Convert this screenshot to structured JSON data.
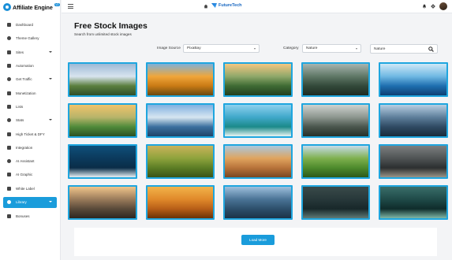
{
  "brand": {
    "name": "Affiliate Engine",
    "badge": "V2"
  },
  "sidebar": {
    "items": [
      {
        "label": "Dashboard",
        "icon": "home-icon",
        "caret": false,
        "active": false
      },
      {
        "label": "Theme Gallery",
        "icon": "palette-icon",
        "caret": false,
        "active": false
      },
      {
        "label": "Sites",
        "icon": "globe-icon",
        "caret": true,
        "active": false
      },
      {
        "label": "Automation",
        "icon": "robot-icon",
        "caret": false,
        "active": false
      },
      {
        "label": "Get Traffic",
        "icon": "chart-icon",
        "caret": true,
        "active": false
      },
      {
        "label": "Monetization",
        "icon": "dollar-icon",
        "caret": false,
        "active": false
      },
      {
        "label": "Lists",
        "icon": "list-icon",
        "caret": false,
        "active": false
      },
      {
        "label": "Stats",
        "icon": "stats-icon",
        "caret": true,
        "active": false
      },
      {
        "label": "High Ticket & DFY",
        "icon": "ticket-icon",
        "caret": false,
        "active": false
      },
      {
        "label": "Integration",
        "icon": "plug-icon",
        "caret": false,
        "active": false
      },
      {
        "label": "AI Assistant",
        "icon": "assistant-icon",
        "caret": false,
        "active": false
      },
      {
        "label": "AI Graphic",
        "icon": "image-icon",
        "caret": false,
        "active": false
      },
      {
        "label": "White Label",
        "icon": "tag-icon",
        "caret": false,
        "active": false
      },
      {
        "label": "Library",
        "icon": "library-icon",
        "caret": true,
        "active": true
      },
      {
        "label": "Bonuses",
        "icon": "gift-icon",
        "caret": false,
        "active": false
      }
    ]
  },
  "topbar": {
    "site_name": "FutureTech"
  },
  "page": {
    "title": "Free Stock Images",
    "subtitle": "Search from unlimited stock images"
  },
  "filters": {
    "image_source_label": "Image Source",
    "image_source_value": "PixaBay",
    "category_label": "Category",
    "category_value": "Nature",
    "search_value": "Nature"
  },
  "images": [
    {
      "subject": "rainbow over lake",
      "colors": [
        "#9db9d6",
        "#d8e4ee",
        "#5b7f3e",
        "#2f4f2a"
      ]
    },
    {
      "subject": "golden tree",
      "colors": [
        "#7fb1d8",
        "#f0a63a",
        "#c97a14",
        "#6a4a12"
      ]
    },
    {
      "subject": "river valley sunset",
      "colors": [
        "#f3c782",
        "#8fa86a",
        "#3f6b34",
        "#234020"
      ]
    },
    {
      "subject": "forest road",
      "colors": [
        "#a8b5b0",
        "#5f7766",
        "#33493a",
        "#1d2b22"
      ]
    },
    {
      "subject": "ocean wave",
      "colors": [
        "#cfe8f7",
        "#6fb8e3",
        "#1f6fb0",
        "#0c3f73"
      ]
    },
    {
      "subject": "green hills sunrise",
      "colors": [
        "#f0c36b",
        "#b7b46a",
        "#4f8a3a",
        "#2b5222"
      ]
    },
    {
      "subject": "mountain lake reflection",
      "colors": [
        "#7fb0e0",
        "#d7e6f0",
        "#3b6f9e",
        "#1e4469"
      ]
    },
    {
      "subject": "surfer wave",
      "colors": [
        "#8fd1ee",
        "#3fa7c9",
        "#1b8a8a",
        "#e9f5f3"
      ]
    },
    {
      "subject": "misty forest",
      "colors": [
        "#cfd3d0",
        "#8c958e",
        "#4a564d",
        "#27312a"
      ]
    },
    {
      "subject": "mountain valley hiker",
      "colors": [
        "#b8cfe3",
        "#5d7e9a",
        "#2f4a63",
        "#1b2c3c"
      ]
    },
    {
      "subject": "yacht aerial ocean",
      "colors": [
        "#0f4f7a",
        "#0b3a5c",
        "#0a2d48",
        "#e8f1f6"
      ]
    },
    {
      "subject": "rice terraces",
      "colors": [
        "#c9b25a",
        "#8ea33c",
        "#5c7d25",
        "#3a5416"
      ]
    },
    {
      "subject": "desert rock formation",
      "colors": [
        "#a9c7de",
        "#e0a45e",
        "#b8733a",
        "#7a4722"
      ]
    },
    {
      "subject": "green hill sky",
      "colors": [
        "#c7dbea",
        "#7fb04e",
        "#4d8a2c",
        "#2d5a19"
      ]
    },
    {
      "subject": "owl on branch",
      "colors": [
        "#7c7f80",
        "#4f5354",
        "#2c2f30",
        "#9a9588"
      ]
    },
    {
      "subject": "rocky coast sunset",
      "colors": [
        "#f0c58a",
        "#9a7b5a",
        "#5a4a3a",
        "#2e2620"
      ]
    },
    {
      "subject": "bird over golden sea",
      "colors": [
        "#f2b34a",
        "#e0892a",
        "#b85f18",
        "#6a3208"
      ]
    },
    {
      "subject": "fjord cliffs",
      "colors": [
        "#9ec0dc",
        "#4a7396",
        "#2d4f6b",
        "#1c3347"
      ]
    },
    {
      "subject": "cat in dark",
      "colors": [
        "#3a4a4a",
        "#27383a",
        "#18282a",
        "#5f7a76"
      ]
    },
    {
      "subject": "dark forest light",
      "colors": [
        "#3a6e6a",
        "#1f4a48",
        "#0f2c2b",
        "#7fb8a8"
      ]
    }
  ],
  "load_more_label": "Load More"
}
